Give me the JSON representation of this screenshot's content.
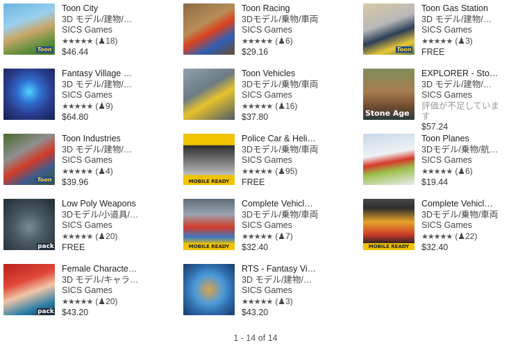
{
  "items": [
    {
      "title": "Toon City",
      "category": "3D モデル/建物/…",
      "publisher": "SICS Games",
      "stars": "★★★★★",
      "rating_count": "(♟18)",
      "price": "$46.44",
      "thumb_label": "Toon"
    },
    {
      "title": "Toon Racing",
      "category": "3Dモデル/乗物/車両",
      "publisher": "SICS Games",
      "stars": "★★★★★",
      "rating_count": "(♟6)",
      "price": "$29.16",
      "thumb_label": ""
    },
    {
      "title": "Toon Gas Station",
      "category": "3D モデル/建物/…",
      "publisher": "SICS Games",
      "stars": "★★★★★",
      "rating_count": "(♟3)",
      "price": "FREE",
      "thumb_label": "Toon"
    },
    {
      "title": "Fantasy Village …",
      "category": "3D モデル/建物/…",
      "publisher": "SICS Games",
      "stars": "★★★★★",
      "rating_count": "(♟9)",
      "price": "$64.80",
      "thumb_label": ""
    },
    {
      "title": "Toon Vehicles",
      "category": "3Dモデル/乗物/車両",
      "publisher": "SICS Games",
      "stars": "★★★★★",
      "rating_count": "(♟16)",
      "price": "$37.80",
      "thumb_label": ""
    },
    {
      "title": "EXPLORER - Sto…",
      "category": "3D モデル/建物/…",
      "publisher": "SICS Games",
      "no_rating": "評価が不足しています",
      "price": "$57.24",
      "thumb_label": "Stone Age"
    },
    {
      "title": "Toon Industries",
      "category": "3D モデル/建物/…",
      "publisher": "SICS Games",
      "stars": "★★★★★",
      "rating_count": "(♟4)",
      "price": "$39.96",
      "thumb_label": "Toon"
    },
    {
      "title": "Police Car & Heli…",
      "category": "3Dモデル/乗物/車両",
      "publisher": "SICS Games",
      "stars": "★★★★★",
      "rating_count": "(♟95)",
      "price": "FREE",
      "thumb_label": "MOBILE READY"
    },
    {
      "title": "Toon Planes",
      "category": "3Dモデル/乗物/航…",
      "publisher": "SICS Games",
      "stars": "★★★★★",
      "rating_count": "(♟6)",
      "price": "$19.44",
      "thumb_label": ""
    },
    {
      "title": "Low Poly Weapons",
      "category": "3Dモデル/小道具/…",
      "publisher": "SICS Games",
      "stars": "★★★★★",
      "rating_count": "(♟20)",
      "price": "FREE",
      "thumb_label": "pack"
    },
    {
      "title": "Complete Vehicl…",
      "category": "3Dモデル/乗物/車両",
      "publisher": "SICS Games",
      "stars": "★★★★★",
      "rating_count": "(♟7)",
      "price": "$32.40",
      "thumb_label": "MOBILE READY"
    },
    {
      "title": "Complete Vehicl…",
      "category": "3Dモデル/乗物/車両",
      "publisher": "SICS Games",
      "stars": "★★★★★",
      "rating_count": "(♟22)",
      "price": "$32.40",
      "thumb_label": "MOBILE READY"
    },
    {
      "title": "Female Characte…",
      "category": "3D モデル/キャラ…",
      "publisher": "SICS Games",
      "stars": "★★★★★",
      "rating_count": "(♟20)",
      "price": "$43.20",
      "thumb_label": "pack"
    },
    {
      "title": "RTS - Fantasy Vi…",
      "category": "3D モデル/建物/…",
      "publisher": "SICS Games",
      "stars": "★★★★★",
      "rating_count": "(♟3)",
      "price": "$43.20",
      "thumb_label": ""
    }
  ],
  "pagination": "1 - 14 of 14"
}
